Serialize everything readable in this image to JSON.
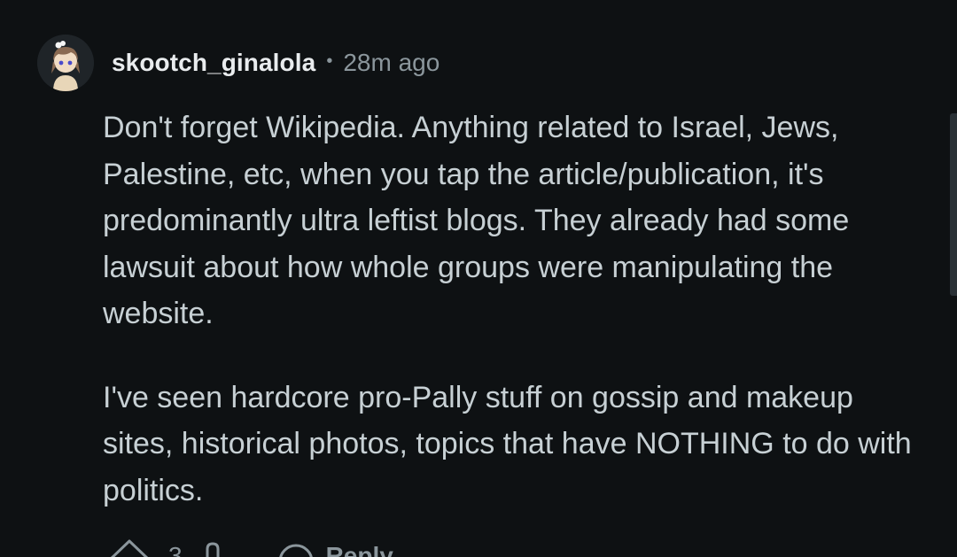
{
  "comment": {
    "author": "skootch_ginalola",
    "separator": "•",
    "timestamp": "28m ago",
    "paragraphs": [
      "Don't forget Wikipedia. Anything related to Israel, Jews, Palestine, etc, when you tap the article/publication, it's predominantly ultra leftist blogs. They already had some lawsuit about how whole groups were manipulating the website.",
      "I've seen hardcore pro-Pally stuff on gossip and makeup sites, historical photos, topics that have NOTHING to do with politics."
    ]
  },
  "actions": {
    "upvote_icon": "upvote-arrow-icon",
    "vote_count": "3",
    "downvote_icon": "downvote-arrow-icon",
    "reply_icon": "chat-bubble-icon",
    "reply_label": "Reply"
  },
  "colors": {
    "background": "#0e1113",
    "author_text": "#e9ecee",
    "body_text": "#c7d0d4",
    "meta_text": "#8b969c"
  }
}
